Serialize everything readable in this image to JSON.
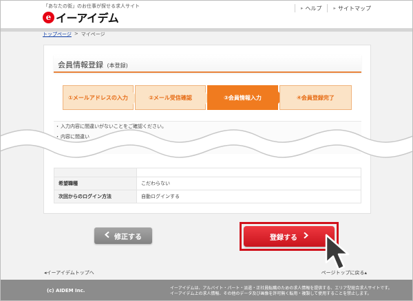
{
  "header": {
    "tagline": "「あなたの街」のお仕事が探せる求人サイト",
    "logo_mark": "e",
    "logo_text": "イーアイデム",
    "links": [
      {
        "label": "ヘルプ"
      },
      {
        "label": "サイトマップ"
      }
    ]
  },
  "breadcrumb": {
    "home": "トップページ",
    "separator": ">",
    "current": "マイページ"
  },
  "page": {
    "title": "会員情報登録",
    "title_note": "(本登録)"
  },
  "steps": [
    {
      "label": "①メールアドレスの入力",
      "state": "done"
    },
    {
      "label": "②メール受信確認",
      "state": "done"
    },
    {
      "label": "③会員情報入力",
      "state": "current"
    },
    {
      "label": "④会員登録完了",
      "state": "pending"
    }
  ],
  "notes": [
    "入力内容に間違いがないことをご確認ください。",
    "内容に間違い"
  ],
  "table": {
    "rows": [
      {
        "label": "希望職種",
        "value": "こだわらない"
      },
      {
        "label": "次回からのログイン方法",
        "value": "自動ログインする"
      }
    ]
  },
  "buttons": {
    "back": "修正する",
    "back_icon": "chevron-left-icon",
    "submit": "登録する",
    "submit_icon": "chevron-right-icon"
  },
  "footer_links": {
    "left": "◂イーアイデムトップへ",
    "right": "ページトップに戻る▴"
  },
  "footer": {
    "copyright": "(c) AIDEM Inc.",
    "note_line1": "イーアイデムは、アルバイト・パート・派遣・正社員転職のための求人情報を提供する、エリア型総合求人サイトです。",
    "note_line2": "イーアイデム上の求人情報、その他のデータ及び画像を許可無く転用・複製して使用することを禁止します。"
  },
  "colors": {
    "brand_red": "#e60012",
    "accent_orange": "#f07b1f",
    "highlight": "#d0111b"
  }
}
